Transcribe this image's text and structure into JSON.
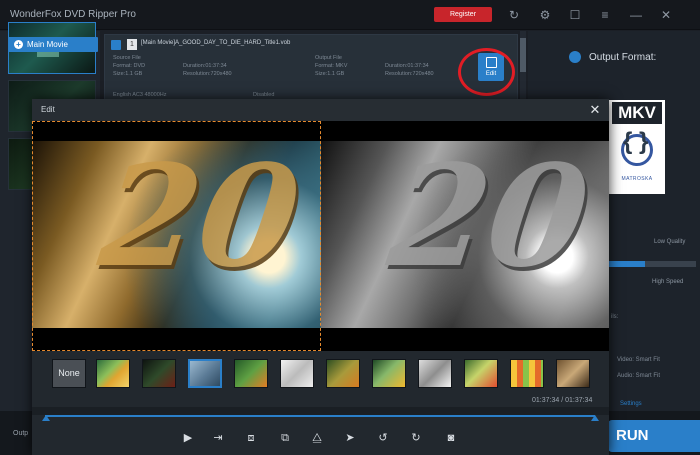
{
  "app": {
    "title": "WonderFox DVD Ripper Pro",
    "register_label": "Register",
    "toolbar_icons": [
      "refresh-icon",
      "gear-icon",
      "help-icon",
      "settings-icon",
      "minimize-icon",
      "close-icon"
    ]
  },
  "left_panel": {
    "main_movie_label": "Main Movie"
  },
  "file_row": {
    "index": "1",
    "name": "[Main Movie]A_GOOD_DAY_TO_DIE_HARD_Title1.vob",
    "source": {
      "heading": "Source File",
      "format": "Format: DVD",
      "duration": "Duration:01:37:34",
      "size": "Size:1.1 GB",
      "resolution": "Resolution:720x480"
    },
    "output": {
      "heading": "Output File",
      "format": "Format: MKV",
      "duration": "Duration:01:37:34",
      "size": "Size:1.1 GB",
      "resolution": "Resolution:720x480"
    },
    "audio": "English AC3 48000Hz",
    "subtitle": "Disabled",
    "edit_label": "Edit"
  },
  "right_panel": {
    "output_format_label": "Output Format:",
    "format_badge": "MKV",
    "format_sub": "MATROSKA",
    "quality_low": "Low Quality",
    "quality_high": "High Speed",
    "quality_level": 0.41,
    "settings_heading": "ils:",
    "settings_lines": [
      "Video: Smart Fit",
      "Audio: Smart Fit"
    ],
    "settings_link": "Settings"
  },
  "bottom": {
    "output_label": "Outp",
    "run_label": "RUN"
  },
  "edit_dialog": {
    "title": "Edit",
    "close_glyph": "✕",
    "filter_none_label": "None",
    "filters": [
      "none",
      "flower",
      "dark-leaf",
      "blue-selected",
      "green-leaf",
      "orange-flower",
      "sketch",
      "green-leaf-2",
      "daisy",
      "emboss",
      "red-flower",
      "color-grid",
      "sepia-leaf"
    ],
    "selected_filter_index": 3,
    "frame_text": "20",
    "time_label": "01:37:34 / 01:37:34",
    "controls": [
      "play-icon",
      "step-forward-icon",
      "mark-in-icon",
      "mark-out-icon",
      "flip-icon",
      "next-frame-icon",
      "rotate-left-icon",
      "rotate-right-icon",
      "snapshot-icon"
    ]
  }
}
